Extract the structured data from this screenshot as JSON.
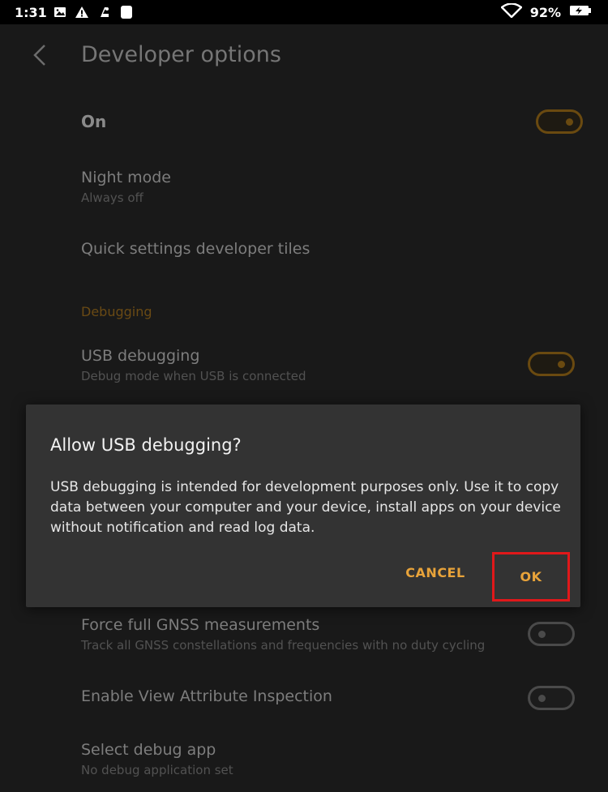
{
  "status_bar": {
    "time": "1:31",
    "battery_percent": "92%",
    "icons": [
      "image-icon",
      "warning-icon",
      "usb-debug-icon",
      "notification-icon",
      "wifi-icon",
      "battery-charging-icon"
    ]
  },
  "app_bar": {
    "title": "Developer options",
    "back_icon": "chevron-left-icon"
  },
  "settings": {
    "master": {
      "label": "On",
      "enabled": true
    },
    "night_mode": {
      "title": "Night mode",
      "subtitle": "Always off"
    },
    "quick_tiles": {
      "title": "Quick settings developer tiles"
    },
    "debugging_header": "Debugging",
    "usb_debugging": {
      "title": "USB debugging",
      "subtitle": "Debug mode when USB is connected",
      "enabled": true
    },
    "gnss": {
      "title": "Force full GNSS measurements",
      "subtitle": "Track all GNSS constellations and frequencies with no duty cycling",
      "enabled": false
    },
    "view_attr": {
      "title": "Enable View Attribute Inspection",
      "enabled": false
    },
    "debug_app": {
      "title": "Select debug app",
      "subtitle": "No debug application set"
    }
  },
  "dialog": {
    "title": "Allow USB debugging?",
    "message": "USB debugging is intended for development purposes only. Use it to copy data between your computer and your device, install apps on your device without notification and read log data.",
    "cancel_label": "CANCEL",
    "ok_label": "OK"
  },
  "colors": {
    "accent": "#e8a33a",
    "highlight_box": "#e0181a",
    "dialog_bg": "#333333",
    "background": "#191919"
  }
}
